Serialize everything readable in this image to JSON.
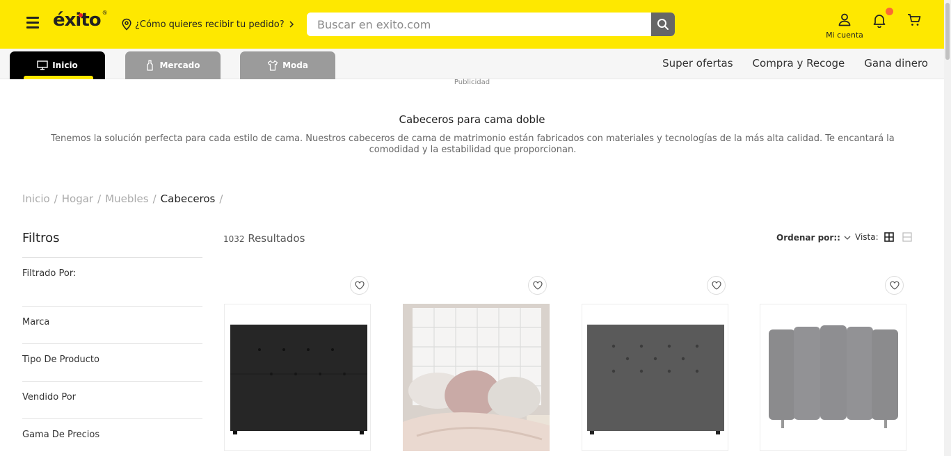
{
  "header": {
    "logo_text": "éxito",
    "delivery_prompt": "¿Cómo quieres recibir tu pedido?",
    "search_placeholder": "Buscar en exito.com",
    "account_label": "Mi cuenta",
    "brand_color": "#fee800"
  },
  "nav": {
    "tabs": [
      {
        "label": "Inicio",
        "icon": "monitor-icon",
        "active": true
      },
      {
        "label": "Mercado",
        "icon": "bottle-icon",
        "active": false
      },
      {
        "label": "Moda",
        "icon": "shirt-icon",
        "active": false
      }
    ],
    "links": [
      "Super ofertas",
      "Compra y Recoge",
      "Gana dinero"
    ]
  },
  "ad_label": "Publicidad",
  "intro": {
    "title": "Cabeceros para cama doble",
    "text": "Tenemos la solución perfecta para cada estilo de cama. Nuestros cabeceros de cama de matrimonio están fabricados con materiales y tecnologías de la más alta calidad. Te encantará la comodidad y la estabilidad que proporcionan."
  },
  "breadcrumb": {
    "items": [
      "Inicio",
      "Hogar",
      "Muebles",
      "Cabeceros"
    ],
    "separator": "/"
  },
  "filters": {
    "title": "Filtros",
    "filtered_by": "Filtrado Por:",
    "items": [
      "Marca",
      "Tipo De Producto",
      "Vendido Por",
      "Gama De Precios"
    ]
  },
  "results": {
    "count": "1032",
    "label": "Resultados"
  },
  "sort": {
    "label": "Ordenar por::",
    "view_label": "Vista:"
  },
  "products": [
    {
      "image": "black-tufted-headboard"
    },
    {
      "image": "white-tufted-headboard-bedroom"
    },
    {
      "image": "dark-gray-tufted-headboard"
    },
    {
      "image": "gray-channel-headboard"
    }
  ]
}
